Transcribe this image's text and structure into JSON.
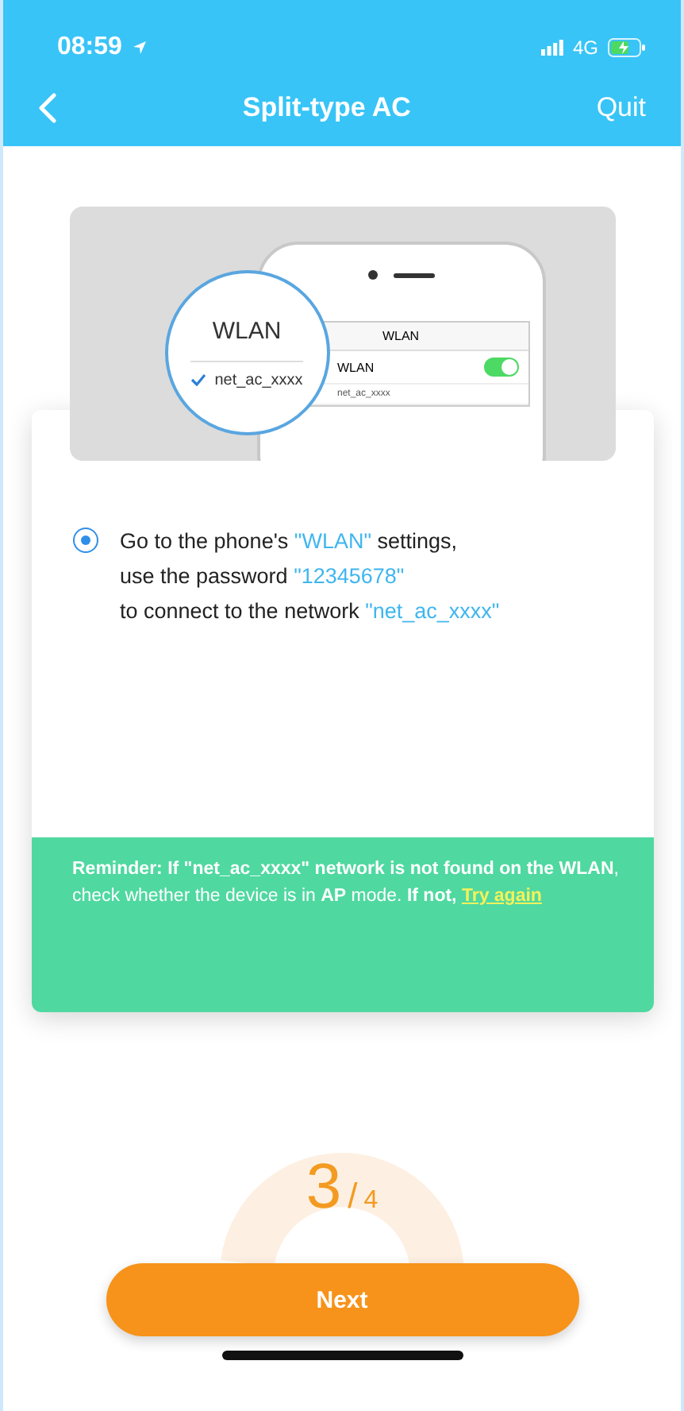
{
  "status_bar": {
    "time": "08:59",
    "network": "4G"
  },
  "nav": {
    "title": "Split-type AC",
    "action": "Quit"
  },
  "illustration": {
    "magnifier_title": "WLAN",
    "magnifier_network": "net_ac_xxxx",
    "screen_title": "WLAN",
    "wlan_row": "WLAN",
    "wlan_on": true,
    "network_row": "net_ac_xxxx"
  },
  "instruction": {
    "selected": true,
    "lines": [
      [
        {
          "text": "Go to the phone's ",
          "highlight": false
        },
        {
          "text": "\"WLAN\"",
          "highlight": true
        },
        {
          "text": " settings,",
          "highlight": false
        }
      ],
      [
        {
          "text": "use the password ",
          "highlight": false
        },
        {
          "text": "\"12345678\"",
          "highlight": true
        }
      ],
      [
        {
          "text": "to connect to the network ",
          "highlight": false
        },
        {
          "text": "\"net_ac_xxxx\"",
          "highlight": true
        }
      ]
    ]
  },
  "reminder": {
    "text": "**Reminder: If \"net_ac_xxxx\" network is not found on the WLAN**, check whether the device is in **AP** mode. **If not,**",
    "link": "Try again"
  },
  "step": {
    "current": "3",
    "separator": "/",
    "total": "4"
  },
  "next_button": "Next"
}
